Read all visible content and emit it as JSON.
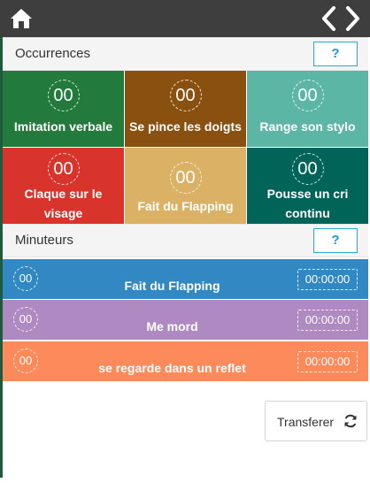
{
  "header": {
    "home_icon": "home-icon",
    "nav_icon": "code-brackets-icon"
  },
  "occurrences": {
    "title": "Occurrences",
    "help_label": "?",
    "tiles": [
      {
        "label": "Imitation verbale",
        "count": "00",
        "color": "#237a3d"
      },
      {
        "label": "Se pince les doigts",
        "count": "00",
        "color": "#8a5010"
      },
      {
        "label": "Range son stylo",
        "count": "00",
        "color": "#5cb6a6"
      },
      {
        "label": "Claque sur le visage",
        "count": "00",
        "color": "#d9342c"
      },
      {
        "label": "Fait du Flapping",
        "count": "00",
        "color": "#dab165"
      },
      {
        "label": "Pousse un cri continu",
        "count": "00",
        "color": "#006558"
      }
    ]
  },
  "timers": {
    "title": "Minuteurs",
    "help_label": "?",
    "rows": [
      {
        "label": "Fait du Flapping",
        "count": "00",
        "time": "00:00:00",
        "color": "#3288c2"
      },
      {
        "label": "Me mord",
        "count": "00",
        "time": "00:00:00",
        "color": "#af8ac2"
      },
      {
        "label": "se regarde dans un reflet",
        "count": "00",
        "time": "00:00:00",
        "color": "#fc8a5a"
      }
    ]
  },
  "footer": {
    "transfer_label": "Transferer",
    "transfer_icon": "refresh-icon"
  }
}
